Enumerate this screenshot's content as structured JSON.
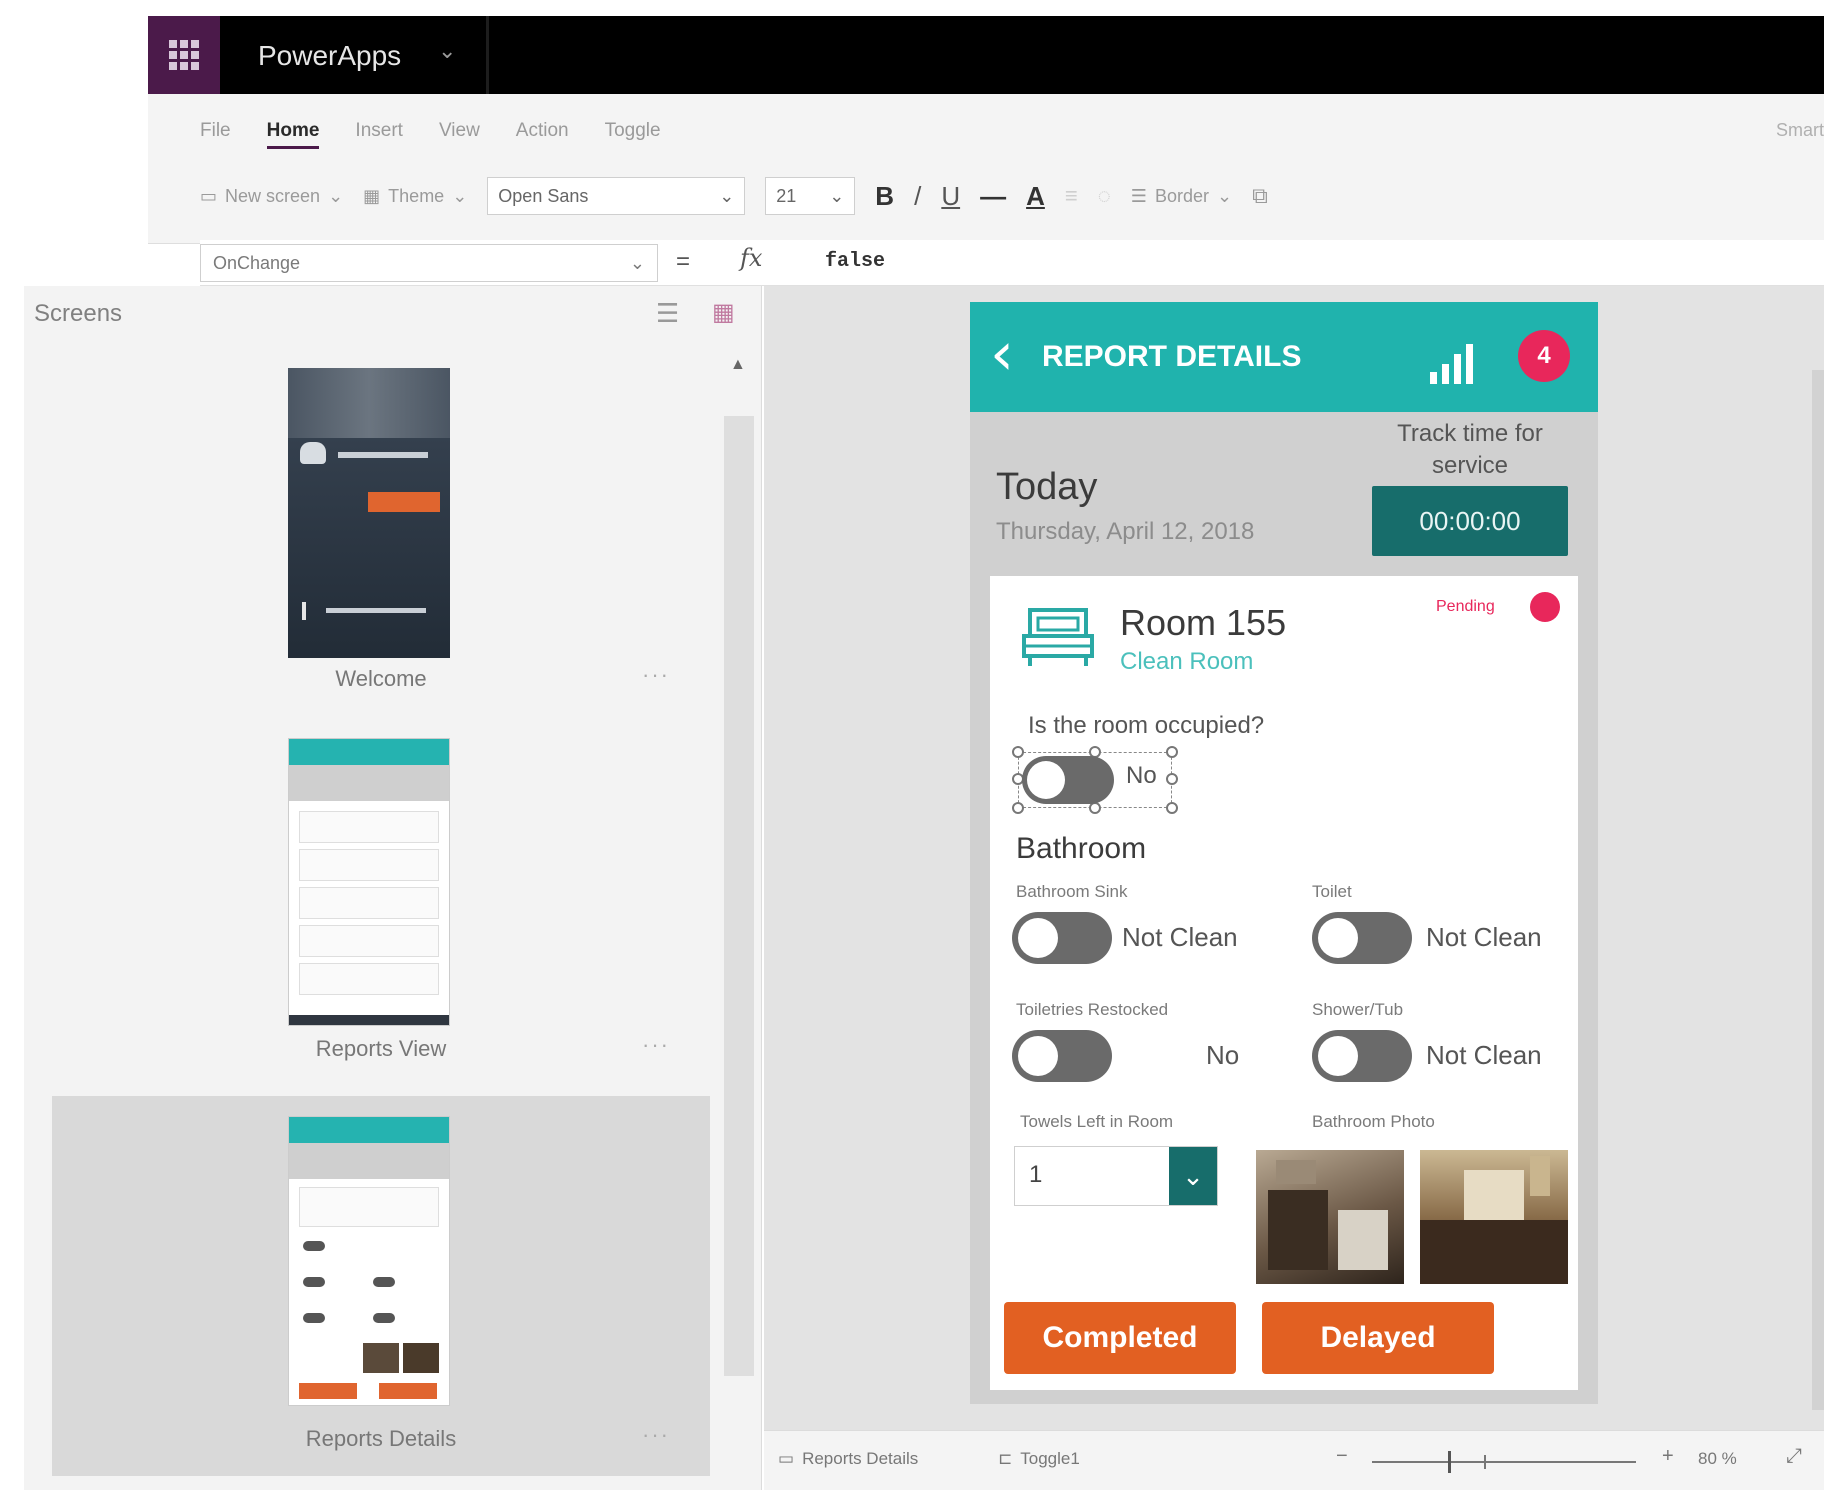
{
  "titlebar": {
    "app_name": "PowerApps",
    "chevron": "⌄"
  },
  "ribbon": {
    "tabs": [
      "File",
      "Home",
      "Insert",
      "View",
      "Action",
      "Toggle"
    ],
    "active_tab": "Home",
    "smart": "Smart",
    "new_screen": "New screen",
    "theme": "Theme",
    "font": "Open Sans",
    "font_size": "21",
    "bold": "B",
    "italic": "/",
    "underline": "U",
    "strike": "—",
    "font_color": "A",
    "border": "Border"
  },
  "formula_bar": {
    "property": "OnChange",
    "equals": "=",
    "fx": "fx",
    "formula": "false"
  },
  "screens_panel": {
    "title": "Screens",
    "screens": [
      {
        "label": "Welcome",
        "more": "···"
      },
      {
        "label": "Reports View",
        "more": "···"
      },
      {
        "label": "Reports Details",
        "more": "···"
      }
    ],
    "selected_index": 2
  },
  "app": {
    "header": {
      "title": "REPORT DETAILS",
      "back": "‹",
      "notification_count": "4"
    },
    "today": "Today",
    "date": "Thursday, April 12, 2018",
    "track_label": "Track time for service",
    "timer": "00:00:00",
    "room": {
      "title": "Room 155",
      "subtitle": "Clean Room",
      "status": "Pending"
    },
    "occupied_question": "Is the room occupied?",
    "occupied_value": "No",
    "bathroom_title": "Bathroom",
    "fields": [
      {
        "label": "Bathroom Sink",
        "value": "Not Clean"
      },
      {
        "label": "Toilet",
        "value": "Not Clean"
      },
      {
        "label": "Toiletries Restocked",
        "value": "No"
      },
      {
        "label": "Shower/Tub",
        "value": "Not Clean"
      }
    ],
    "towels_label": "Towels Left in Room",
    "towels_value": "1",
    "photo_label": "Bathroom Photo",
    "buttons": {
      "completed": "Completed",
      "delayed": "Delayed"
    }
  },
  "statusbar": {
    "screen": "Reports Details",
    "control": "Toggle1",
    "zoom_minus": "−",
    "zoom_plus": "+",
    "zoom_pct": "80 %"
  },
  "colors": {
    "teal": "#20b3ad",
    "dark_teal": "#176d6b",
    "orange": "#e26022",
    "pink": "#e8275b",
    "purple": "#4b1a4a"
  }
}
